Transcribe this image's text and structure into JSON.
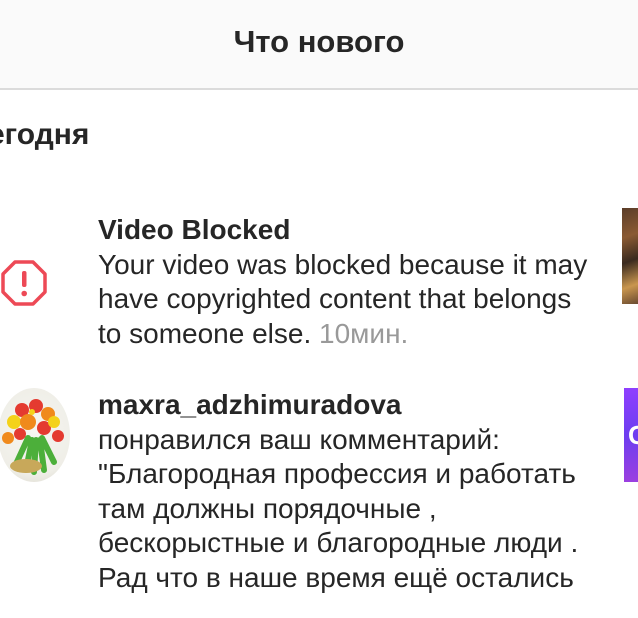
{
  "header": {
    "title": "Что нового"
  },
  "section": {
    "title": "егодня"
  },
  "notifications": [
    {
      "icon": "alert-octagon-icon",
      "title": "Video Blocked",
      "body": "Your video was blocked because it may have copyrighted content that belongs to someone else. ",
      "time": "10мин."
    },
    {
      "icon": "avatar",
      "username": "maxra_adzhimuradova",
      "body": "понравился ваш комментарий: \"Благородная профессия и работать там должны порядочные , бескорыстные и благородные люди . Рад что в наше время ещё остались",
      "thumb_text": "С"
    }
  ]
}
